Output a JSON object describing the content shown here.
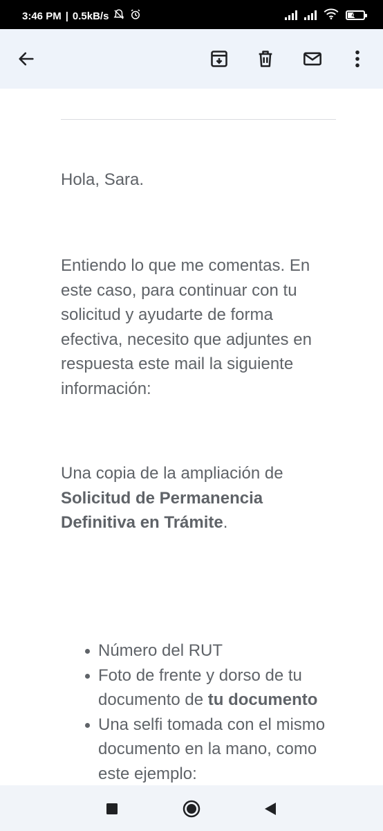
{
  "status_bar": {
    "time": "3:46 PM",
    "net_speed": "0.5kB/s",
    "battery": "41"
  },
  "toolbar": {
    "icons": [
      "back-arrow-icon",
      "archive-icon",
      "delete-icon",
      "mail-icon",
      "more-vert-icon"
    ]
  },
  "email": {
    "greeting": "Hola, Sara.",
    "body_paragraph": "Entiendo lo que me comentas. En este caso, para continuar con tu solicitud y ayudarte de forma efectiva, necesito que adjuntes en respuesta este mail la siguiente información:",
    "request_prefix": "Una copia de la ampliación de ",
    "request_bold": "Solicitud de Permanencia Definitiva en Trámite",
    "request_suffix": ".",
    "list": {
      "item1": "Número del RUT",
      "item2_prefix": "Foto de frente y dorso de tu documento de ",
      "item2_bold": "tu documento",
      "item3": "Una selfi tomada con el mismo documento en la mano, como este ejemplo:"
    }
  },
  "nav_bar": {
    "icons": [
      "recents-square-icon",
      "home-circle-icon",
      "back-triangle-icon"
    ]
  }
}
